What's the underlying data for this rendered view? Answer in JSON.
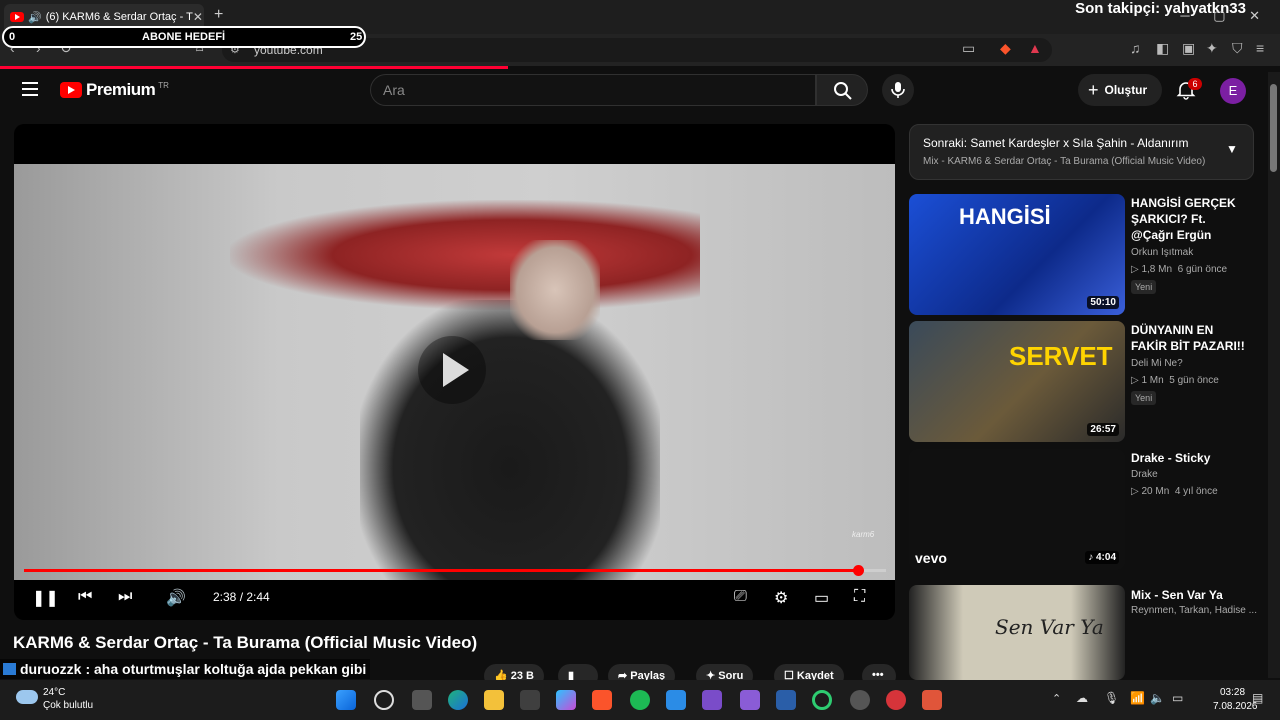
{
  "browser": {
    "tab_title": "(6) KARM6 & Serdar Ortaç - T",
    "url": "youtube.com",
    "new_tab": "+"
  },
  "stream_overlay": {
    "goal_start": "0",
    "goal_label": "ABONE HEDEFİ",
    "goal_target": "25",
    "last_follower": "Son takipçi: yahyatkn33"
  },
  "header": {
    "logo_text": "Premium",
    "region": "TR",
    "search_placeholder": "Ara",
    "create_label": "Oluştur",
    "notification_count": "6",
    "avatar_letter": "E"
  },
  "player": {
    "time": "2:38 / 2:44",
    "progress": 0.967,
    "watermark": "karm6"
  },
  "video": {
    "title": "KARM6 & Serdar Ortaç - Ta Burama (Official Music Video)",
    "likes": "23 B",
    "share": "Paylaş",
    "ask": "Soru",
    "save": "Kaydet"
  },
  "chat_overlay": {
    "user": "duruozzk",
    "message": ": aha oturtmuşlar koltuğa ajda pekkan gibi"
  },
  "up_next": {
    "title": "Sonraki: Samet Kardeşler x Sıla Şahin - Aldanırım",
    "subtitle": "Mix - KARM6 & Serdar Ortaç - Ta Burama (Official Music Video)"
  },
  "related": [
    {
      "title": "HANGİSİ GERÇEK ŞARKICI? Ft. @Çağrı Ergün",
      "channel": "Orkun Işıtmak",
      "views": "1,8 Mn",
      "age": "6 gün önce",
      "badge": "Yeni",
      "duration": "50:10",
      "thumb_text": "HANGİSİ"
    },
    {
      "title": "DÜNYANIN EN FAKİR BİT PAZARI!!",
      "channel": "Deli Mi Ne?",
      "views": "1 Mn",
      "age": "5 gün önce",
      "badge": "Yeni",
      "duration": "26:57",
      "thumb_text": "SERVET"
    },
    {
      "title": "Drake - Sticky",
      "channel": "Drake",
      "views": "20 Mn",
      "age": "4 yıl önce",
      "badge": "",
      "duration": "4:04",
      "thumb_text": "vevo"
    },
    {
      "title": "Mix - Sen Var Ya",
      "channel": "Reynmen, Tarkan, Hadise ...",
      "views": "",
      "age": "",
      "badge": "",
      "duration": "",
      "thumb_text": "Sen Var Ya"
    }
  ],
  "taskbar": {
    "temp": "24°C",
    "weather": "Çok bulutlu",
    "time": "03:28",
    "date": "7.08.2026"
  }
}
